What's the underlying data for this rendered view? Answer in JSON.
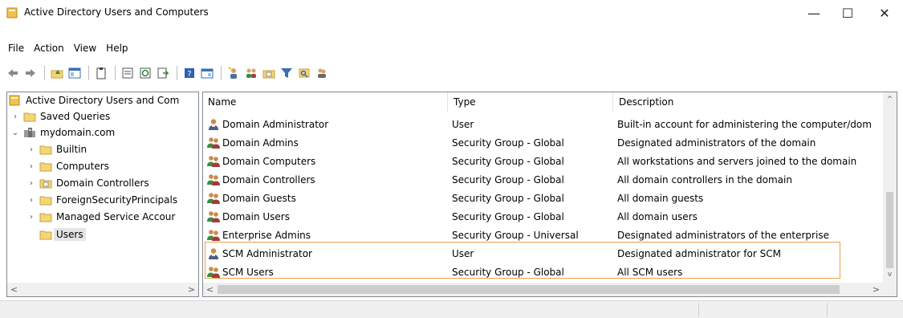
{
  "window": {
    "title": "Active Directory Users and Computers",
    "controls": {
      "minimize": "—",
      "maximize": "☐",
      "close": "✕"
    }
  },
  "menu": [
    "File",
    "Action",
    "View",
    "Help"
  ],
  "toolbar_icons": [
    "back-arrow-icon",
    "forward-arrow-icon",
    "up-folder-icon",
    "show-hide-console-tree-icon",
    "clipboard-icon",
    "properties-icon",
    "refresh-icon",
    "export-list-icon",
    "help-icon",
    "console-tree-icon",
    "new-user-icon",
    "new-group-icon",
    "new-ou-icon",
    "filter-icon",
    "find-icon",
    "add-to-group-icon"
  ],
  "tree": {
    "root": "Active Directory Users and Com",
    "items": [
      {
        "label": "Saved Queries",
        "level": 1,
        "expander": "›",
        "icon": "folder-icon"
      },
      {
        "label": "mydomain.com",
        "level": 1,
        "expander": "⌄",
        "icon": "domain-icon"
      },
      {
        "label": "Builtin",
        "level": 2,
        "expander": "›",
        "icon": "folder-icon"
      },
      {
        "label": "Computers",
        "level": 2,
        "expander": "›",
        "icon": "folder-icon"
      },
      {
        "label": "Domain Controllers",
        "level": 2,
        "expander": "›",
        "icon": "ou-icon"
      },
      {
        "label": "ForeignSecurityPrincipals",
        "level": 2,
        "expander": "›",
        "icon": "folder-icon"
      },
      {
        "label": "Managed Service Accour",
        "level": 2,
        "expander": "›",
        "icon": "folder-icon"
      },
      {
        "label": "Users",
        "level": 2,
        "expander": "",
        "icon": "folder-icon",
        "selected": true
      }
    ]
  },
  "list": {
    "columns": [
      "Name",
      "Type",
      "Description"
    ],
    "rows": [
      {
        "name": "Domain Administrator",
        "type": "User",
        "description": "Built-in account for administering the computer/dom",
        "icon": "user-icon"
      },
      {
        "name": "Domain Admins",
        "type": "Security Group - Global",
        "description": "Designated administrators of the domain",
        "icon": "group-icon"
      },
      {
        "name": "Domain Computers",
        "type": "Security Group - Global",
        "description": "All workstations and servers joined to the domain",
        "icon": "group-icon"
      },
      {
        "name": "Domain Controllers",
        "type": "Security Group - Global",
        "description": "All domain controllers in the domain",
        "icon": "group-icon"
      },
      {
        "name": "Domain Guests",
        "type": "Security Group - Global",
        "description": "All domain guests",
        "icon": "group-icon"
      },
      {
        "name": "Domain Users",
        "type": "Security Group - Global",
        "description": "All domain users",
        "icon": "group-icon"
      },
      {
        "name": "Enterprise Admins",
        "type": "Security Group - Universal",
        "description": "Designated administrators of the enterprise",
        "icon": "group-icon"
      },
      {
        "name": "SCM Administrator",
        "type": "User",
        "description": "Designated administrator for SCM",
        "icon": "user-icon"
      },
      {
        "name": "SCM Users",
        "type": "Security Group - Global",
        "description": "All SCM users",
        "icon": "group-icon"
      }
    ]
  },
  "colors": {
    "highlight_border": "#f0a048",
    "selection": "#e5e5e5",
    "folder": "#f5d57a"
  }
}
